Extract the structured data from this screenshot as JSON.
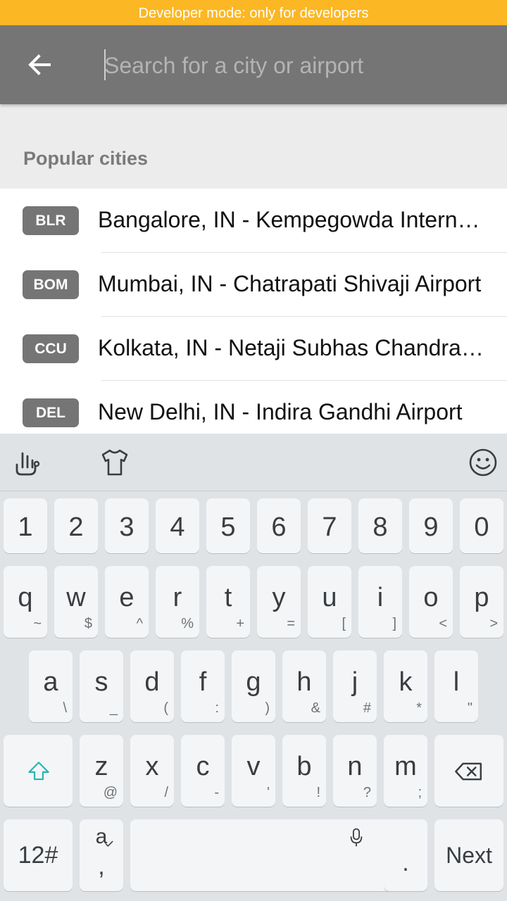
{
  "dev_banner": "Developer mode: only for developers",
  "search": {
    "placeholder": "Search for a city or airport",
    "value": ""
  },
  "section_title": "Popular cities",
  "cities": [
    {
      "code": "BLR",
      "name": "Bangalore, IN - Kempegowda International Airport"
    },
    {
      "code": "BOM",
      "name": "Mumbai, IN - Chatrapati Shivaji Airport"
    },
    {
      "code": "CCU",
      "name": "Kolkata, IN - Netaji Subhas Chandra Bose Airport"
    },
    {
      "code": "DEL",
      "name": "New Delhi, IN - Indira Gandhi Airport"
    }
  ],
  "keyboard": {
    "numbers": [
      "1",
      "2",
      "3",
      "4",
      "5",
      "6",
      "7",
      "8",
      "9",
      "0"
    ],
    "row1": [
      {
        "k": "q",
        "s": "~"
      },
      {
        "k": "w",
        "s": "$"
      },
      {
        "k": "e",
        "s": "^"
      },
      {
        "k": "r",
        "s": "%"
      },
      {
        "k": "t",
        "s": "+"
      },
      {
        "k": "y",
        "s": "="
      },
      {
        "k": "u",
        "s": "["
      },
      {
        "k": "i",
        "s": "]"
      },
      {
        "k": "o",
        "s": "<"
      },
      {
        "k": "p",
        "s": ">"
      }
    ],
    "row2": [
      {
        "k": "a",
        "s": "\\"
      },
      {
        "k": "s",
        "s": "_"
      },
      {
        "k": "d",
        "s": "("
      },
      {
        "k": "f",
        "s": ":"
      },
      {
        "k": "g",
        "s": ")"
      },
      {
        "k": "h",
        "s": "&"
      },
      {
        "k": "j",
        "s": "#"
      },
      {
        "k": "k",
        "s": "*"
      },
      {
        "k": "l",
        "s": "\""
      }
    ],
    "row3": [
      {
        "k": "z",
        "s": "@"
      },
      {
        "k": "x",
        "s": "/"
      },
      {
        "k": "c",
        "s": "-"
      },
      {
        "k": "v",
        "s": "'"
      },
      {
        "k": "b",
        "s": "!"
      },
      {
        "k": "n",
        "s": "?"
      },
      {
        "k": "m",
        "s": ";"
      }
    ],
    "symbols_label": "12#",
    "lang_key_top": "a",
    "lang_key_bottom": ",",
    "period_label": ".",
    "next_label": "Next"
  },
  "colors": {
    "accent": "#fbb724",
    "appbar": "#757575",
    "badge": "#757575",
    "shift_icon": "#2bb5b0"
  }
}
